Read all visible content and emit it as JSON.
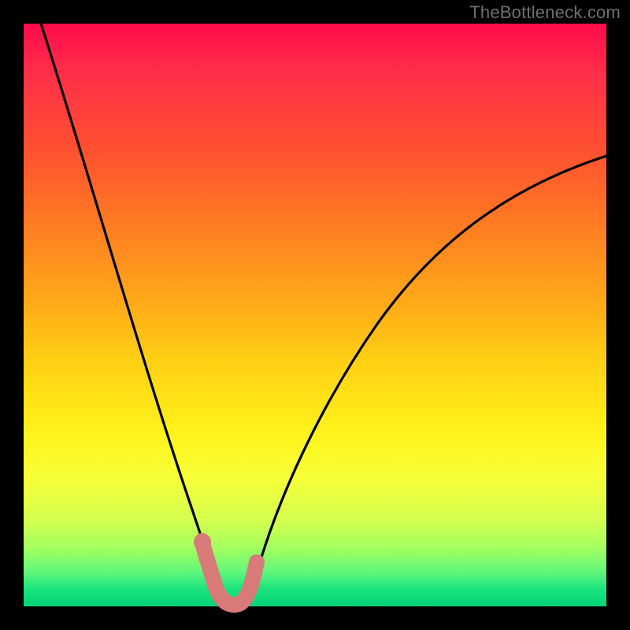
{
  "watermark": "TheBottleneck.com",
  "chart_data": {
    "type": "line",
    "title": "",
    "xlabel": "",
    "ylabel": "",
    "xlim": [
      0,
      100
    ],
    "ylim": [
      0,
      100
    ],
    "grid": false,
    "legend": false,
    "series": [
      {
        "name": "bottleneck-curve",
        "color": "#000000",
        "points": [
          {
            "x": 3,
            "y": 100
          },
          {
            "x": 10,
            "y": 72
          },
          {
            "x": 17,
            "y": 46
          },
          {
            "x": 24,
            "y": 22
          },
          {
            "x": 28,
            "y": 10
          },
          {
            "x": 30,
            "y": 5
          },
          {
            "x": 32,
            "y": 1
          },
          {
            "x": 34,
            "y": 0
          },
          {
            "x": 36,
            "y": 0
          },
          {
            "x": 38,
            "y": 1
          },
          {
            "x": 40,
            "y": 5
          },
          {
            "x": 45,
            "y": 16
          },
          {
            "x": 52,
            "y": 30
          },
          {
            "x": 60,
            "y": 43
          },
          {
            "x": 70,
            "y": 56
          },
          {
            "x": 80,
            "y": 65
          },
          {
            "x": 90,
            "y": 72
          },
          {
            "x": 100,
            "y": 77
          }
        ]
      },
      {
        "name": "highlight-marker",
        "color": "#d87a78",
        "points": [
          {
            "x": 30,
            "y": 6
          },
          {
            "x": 31,
            "y": 2
          },
          {
            "x": 32,
            "y": 0.5
          },
          {
            "x": 34,
            "y": 0
          },
          {
            "x": 36,
            "y": 0
          },
          {
            "x": 37,
            "y": 0.5
          },
          {
            "x": 38,
            "y": 2
          },
          {
            "x": 39,
            "y": 5
          }
        ]
      }
    ],
    "background": "rainbow-gradient-red-to-green"
  }
}
